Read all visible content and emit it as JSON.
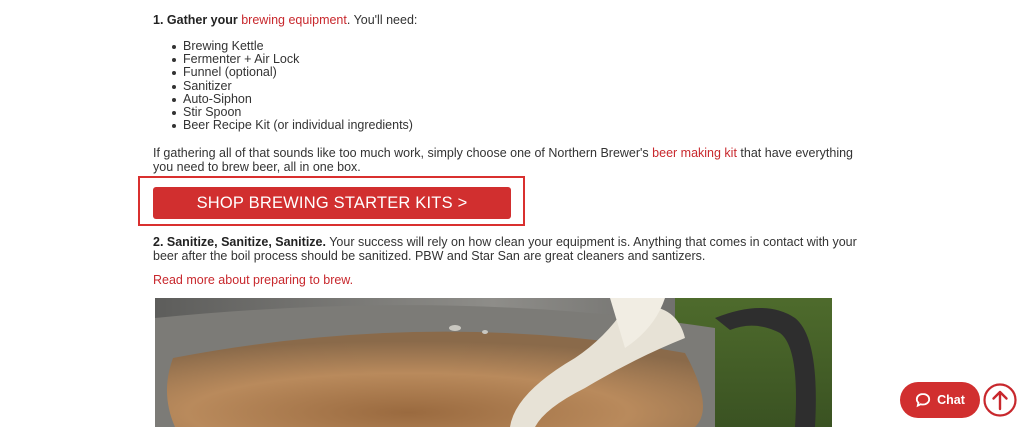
{
  "step1": {
    "number": "1. Gather your",
    "link": "brewing equipment",
    "suffix": ". You'll need:"
  },
  "equipment": [
    "Brewing Kettle",
    "Fermenter + Air Lock",
    "Funnel (optional)",
    "Sanitizer",
    "Auto-Siphon",
    "Stir Spoon",
    "Beer Recipe Kit (or individual ingredients)"
  ],
  "para1": {
    "before": "If gathering all of that sounds like too much work, simply choose one of Northern Brewer's",
    "link": "beer making kit",
    "after": "that have everything you need to brew beer, all in one box."
  },
  "cta": {
    "label": "SHOP BREWING STARTER KITS >"
  },
  "step2": {
    "heading": "2. Sanitize, Sanitize, Sanitize.",
    "text": "Your success will rely on how clean your equipment is. Anything that comes in contact with your beer after the boil process should be sanitized. PBW and Star San are great cleaners and santizers."
  },
  "read_more": "Read more about preparing to brew.",
  "chat": {
    "label": "Chat",
    "icon": "chat-bubble-icon"
  },
  "scroll_top": {
    "icon": "arrow-up-circle-icon"
  },
  "colors": {
    "accent": "#d12f2f",
    "link": "#c8282d",
    "text": "#333333"
  }
}
